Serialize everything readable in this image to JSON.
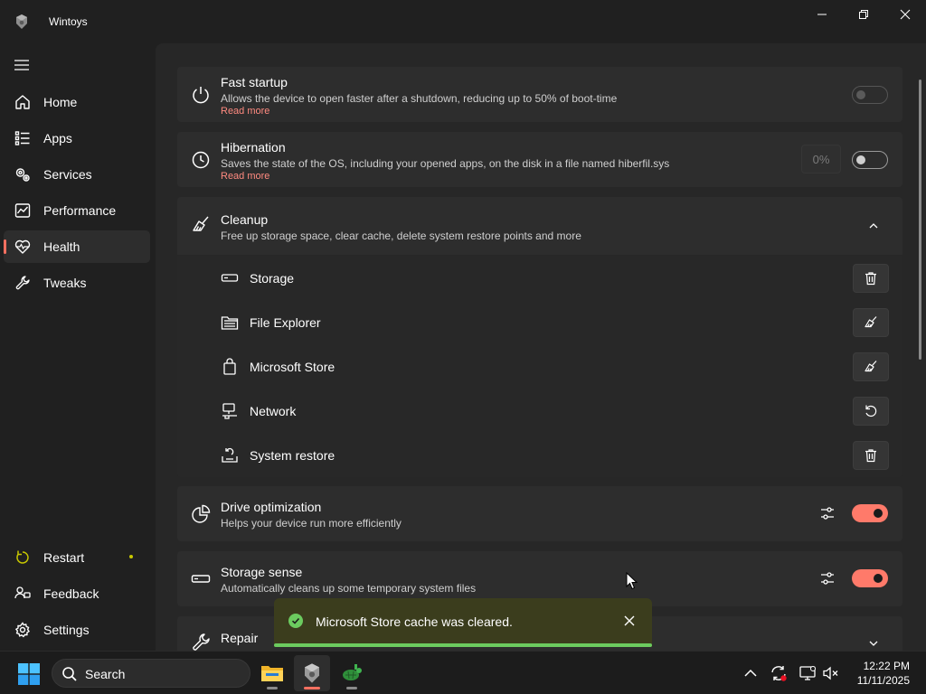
{
  "window": {
    "title": "Wintoys"
  },
  "sidebar": {
    "items": [
      {
        "label": "Home",
        "icon": "home-icon"
      },
      {
        "label": "Apps",
        "icon": "apps-list-icon"
      },
      {
        "label": "Services",
        "icon": "gears-icon"
      },
      {
        "label": "Performance",
        "icon": "chart-icon"
      },
      {
        "label": "Health",
        "icon": "heart-pulse-icon",
        "active": true
      },
      {
        "label": "Tweaks",
        "icon": "wrench-icon"
      }
    ],
    "bottom_items": [
      {
        "label": "Restart",
        "icon": "restart-icon",
        "badge": "dot"
      },
      {
        "label": "Feedback",
        "icon": "feedback-icon"
      },
      {
        "label": "Settings",
        "icon": "gear-icon"
      }
    ]
  },
  "cards": {
    "fast_startup": {
      "title": "Fast startup",
      "description": "Allows the device to open faster after a shutdown, reducing up to 50% of boot-time",
      "link": "Read more",
      "toggle": "off",
      "disabled": true
    },
    "hibernation": {
      "title": "Hibernation",
      "description": "Saves the state of the OS, including your opened apps, on the disk in a file named hiberfil.sys",
      "link": "Read more",
      "percent": "0%",
      "toggle": "off"
    },
    "cleanup": {
      "title": "Cleanup",
      "description": "Free up storage space, clear cache, delete system restore points and more",
      "expanded": true,
      "items": [
        {
          "label": "Storage",
          "icon": "drive-icon",
          "action": "trash-icon"
        },
        {
          "label": "File Explorer",
          "icon": "folder-icon",
          "action": "broom-icon"
        },
        {
          "label": "Microsoft Store",
          "icon": "store-bag-icon",
          "action": "broom-icon"
        },
        {
          "label": "Network",
          "icon": "network-icon",
          "action": "refresh-icon"
        },
        {
          "label": "System restore",
          "icon": "system-restore-icon",
          "action": "trash-icon"
        }
      ]
    },
    "drive_optimization": {
      "title": "Drive optimization",
      "description": "Helps your device run more efficiently",
      "toggle": "on"
    },
    "storage_sense": {
      "title": "Storage sense",
      "description": "Automatically cleans up some temporary system files",
      "toggle": "on"
    },
    "repair": {
      "title": "Repair"
    }
  },
  "toast": {
    "message": "Microsoft Store cache was cleared.",
    "status": "success",
    "progress": 1.0
  },
  "taskbar": {
    "search_placeholder": "Search",
    "time": "12:22 PM",
    "date": "11/11/2025"
  },
  "colors": {
    "accent": "#ff7a6a",
    "success": "#6ccb5f",
    "toast_bg": "#3b3d1d"
  }
}
